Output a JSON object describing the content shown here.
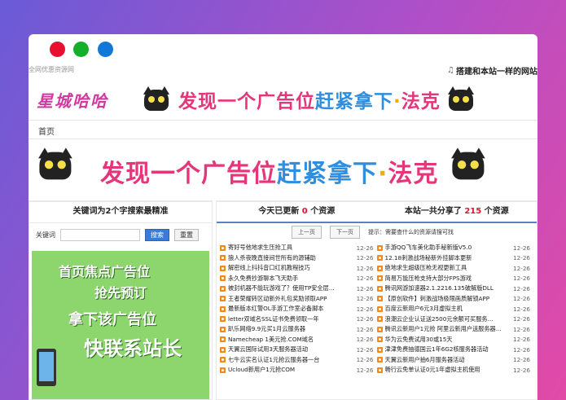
{
  "topbar": {
    "site_tag": "全网优惠资源网",
    "build_link": "搭建和本站一样的网站"
  },
  "logo": {
    "text": "星城哈哈"
  },
  "banner": {
    "text_a": "发现一个广告位",
    "text_b": "赶紧拿下",
    "text_c": "法克"
  },
  "nav": {
    "home": "首页"
  },
  "left": {
    "title": "关键词为2个字搜索最精准",
    "keyword_label": "关键词",
    "keyword_value": "",
    "search_btn": "搜索",
    "reset_btn": "重置",
    "ad_line1": "首页焦点广告位",
    "ad_line2": "抢先预订",
    "ad_line3": "拿下该广告位",
    "ad_line4": "快联系站长"
  },
  "right": {
    "today_prefix": "今天已更新",
    "today_count": "0",
    "today_suffix": "个资源",
    "total_prefix": "本站一共分享了",
    "total_count": "215",
    "total_suffix": "个资源",
    "prev_btn": "上一页",
    "next_btn": "下一页",
    "tip": "提示：需要查什么的资源请搜可找",
    "list_left": [
      {
        "title": "寄好号他地求生压抢工具",
        "date": "12-26"
      },
      {
        "title": "狼人杀夜晚直接间世所有的源辅助",
        "date": "12-26"
      },
      {
        "title": "解密线上抖抖音口红机教程技巧",
        "date": "12-26"
      },
      {
        "title": "永久免费抄游聊本飞天助手",
        "date": "12-26"
      },
      {
        "title": "被封机器不能玩游戏了？使用TP安全层...",
        "date": "12-26"
      },
      {
        "title": "王者荣耀转区动新外礼包奖励领取APP",
        "date": "12-26"
      },
      {
        "title": "最新版本红警OL手游工作室必备脚本",
        "date": "12-26"
      },
      {
        "title": "letter双域名SSL证书免费领取一年",
        "date": "12-26"
      },
      {
        "title": "趴乐网络9.9元买1月云服务器",
        "date": "12-26"
      },
      {
        "title": "Namecheap 1美元抢.COM域名",
        "date": "12-26"
      },
      {
        "title": "天翼云国际试用3天服务器活动",
        "date": "12-26"
      },
      {
        "title": "七牛云实名认证1元抢云服务器一台",
        "date": "12-26"
      },
      {
        "title": "Ucloud新用户1元抢COM",
        "date": "12-26"
      }
    ],
    "list_right": [
      {
        "title": "手游QQ飞车美化助手秘新版V5.0",
        "date": "12-26"
      },
      {
        "title": "12.18刺激战场秘新外挂脚本更新",
        "date": "12-26"
      },
      {
        "title": "绝地求生超级压枪无视更新工具",
        "date": "12-26"
      },
      {
        "title": "简易万能压枪支持大部分FPS游戏",
        "date": "12-26"
      },
      {
        "title": "腾讯网游加速器2.1.2216.135破解版DLL",
        "date": "12-26"
      },
      {
        "title": "【原创软件】刺激战场极限画质解锁APP",
        "date": "12-26"
      },
      {
        "title": "百度云新用户6元3月虚拟主机",
        "date": "12-26"
      },
      {
        "title": "浪潮云企业认证送2500元余额可买服务...",
        "date": "12-26"
      },
      {
        "title": "腾讯云新用户1元抢 阿里云新用户送服务器...",
        "date": "12-26"
      },
      {
        "title": "华为云免费试用30或15天",
        "date": "12-26"
      },
      {
        "title": "津津免费抽德国云1年6G2核服务器活动",
        "date": "12-26"
      },
      {
        "title": "天翼云新用户抽6月服务器活动",
        "date": "12-26"
      },
      {
        "title": "畅行云免单认证0元1年虚拟主机使用",
        "date": "12-26"
      }
    ]
  }
}
